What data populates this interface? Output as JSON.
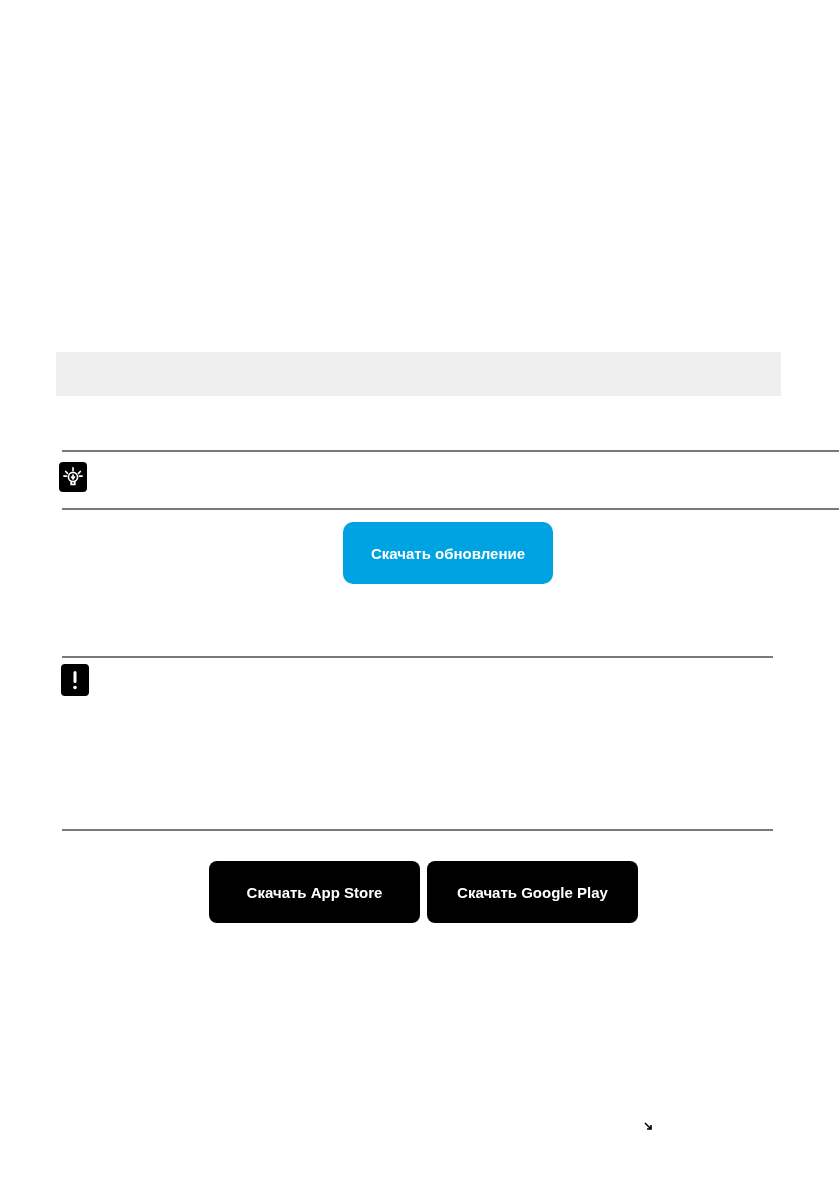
{
  "update_button": {
    "label": "Скачать обновление"
  },
  "store_buttons": [
    {
      "label": "Скачать App Store"
    },
    {
      "label": "Скачать Google Play"
    }
  ]
}
